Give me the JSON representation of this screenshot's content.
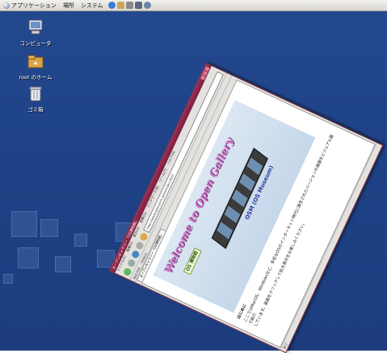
{
  "panel": {
    "menus": [
      {
        "label": "アプリケーション"
      },
      {
        "label": "場所"
      },
      {
        "label": "システム"
      }
    ],
    "launchers": [
      {
        "icon": "browser-icon",
        "color": "#3a7bd5"
      },
      {
        "icon": "mail-icon",
        "color": "#c9a45a"
      },
      {
        "icon": "office-icon",
        "color": "#8a8a8a"
      },
      {
        "icon": "terminal-icon",
        "color": "#5a6b80"
      },
      {
        "icon": "help-icon",
        "color": "#6b85a8"
      }
    ]
  },
  "desktop_icons": [
    {
      "label": "コンピュータ",
      "icon": "computer-icon"
    },
    {
      "label": "root のホーム",
      "icon": "home-folder-icon"
    },
    {
      "label": "ゴミ箱",
      "icon": "trash-icon"
    }
  ],
  "browser": {
    "title": "オープンギャラリー「OS博物館」",
    "menus": [
      "ファイル(F)",
      "編集(E)",
      "表示(V)",
      "移動(G)",
      "ブックマーク(B)",
      "ツール(T)",
      "ヘルプ(H)"
    ],
    "url": "http://www.openarch.jp/os/index.html",
    "bookmarks": [
      "Red Hat",
      "Fedora"
    ],
    "tab": "オープンギャラリー「OS博物館」",
    "status": "完了"
  },
  "page": {
    "welcome": "Welcome to Open Gallery",
    "badge": "OS 博物館",
    "osm": "OSM (OS Museum)",
    "heading": "はじめに",
    "body_line1": "ここではMacOS、Windowsなど、多彩なOSのインターネット時代に誕生されたバージョンの画面をビジュアル面で紹介",
    "body_line2": "しています。画面をクリックして拡大表示をお楽しみください。"
  }
}
